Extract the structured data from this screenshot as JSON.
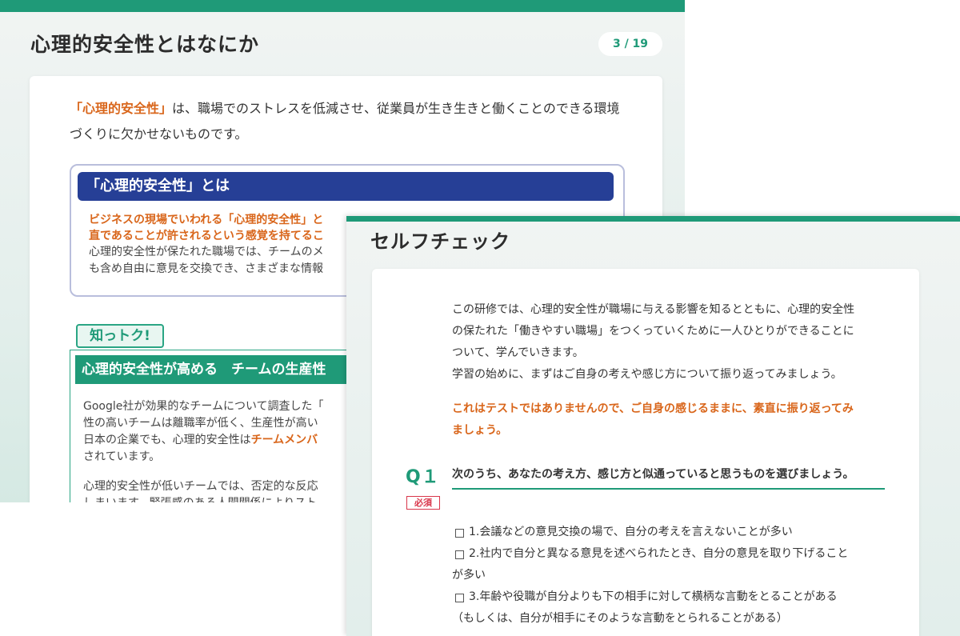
{
  "slide1": {
    "title": "心理的安全性とはなにか",
    "page_indicator": "3 / 19",
    "intro_highlight": "「心理的安全性」",
    "intro_rest": "は、職場でのストレスを低減させ、従業員が生き生きと働くことのできる環境づくりに欠かせないものです。",
    "definition": {
      "heading": "「心理的安全性」とは",
      "orange_line1": "ビジネスの現場でいわれる「心理的安全性」と",
      "orange_line2": "直であることが許されるという感覚を持てるこ",
      "body_line1": "心理的安全性が保たれた職場では、チームのメ",
      "body_line2": "も含め自由に意見を交換でき、さまざまな情報"
    },
    "tip": {
      "tab_label": "知っトク!",
      "heading": "心理的安全性が高める　チームの生産性",
      "body_line1": "Google社が効果的なチームについて調査した「",
      "body_line2": "性の高いチームは離職率が低く、生産性が高い",
      "body_line3_pre": "日本の企業でも、心理的安全性は",
      "body_line3_highlight": "チームメンバ",
      "body_line4": "されています。",
      "body_line5": "心理的安全性が低いチームでは、否定的な反応",
      "body_line6": "しまいます。緊張感のある人間関係によりスト"
    }
  },
  "slide2": {
    "title": "セルフチェック",
    "intro": [
      "この研修では、心理的安全性が職場に与える影響を知るとともに、心理的安全性",
      "の保たれた「働きやすい職場」をつくっていくために一人ひとりができることに",
      "ついて、学んでいきます。",
      "学習の始めに、まずはご自身の考えや感じ方について振り返ってみましょう。"
    ],
    "note": [
      "これはテストではありませんので、ご自身の感じるままに、素直に振り返ってみ",
      "ましょう。"
    ],
    "question": {
      "label": "Q１",
      "text": "次のうち、あなたの考え方、感じ方と似通っていると思うものを選びましょう。",
      "required_badge": "必須",
      "options": [
        "1.会議などの意見交換の場で、自分の考えを言えないことが多い",
        "2.社内で自分と異なる意見を述べられたとき、自分の意見を取り下げること",
        "3.年齢や役職が自分よりも下の相手に対して横柄な言動をとることがある"
      ],
      "option2_cont": "が多い",
      "option3_cont": "（もしくは、自分が相手にそのような言動をとられることがある）"
    }
  }
}
